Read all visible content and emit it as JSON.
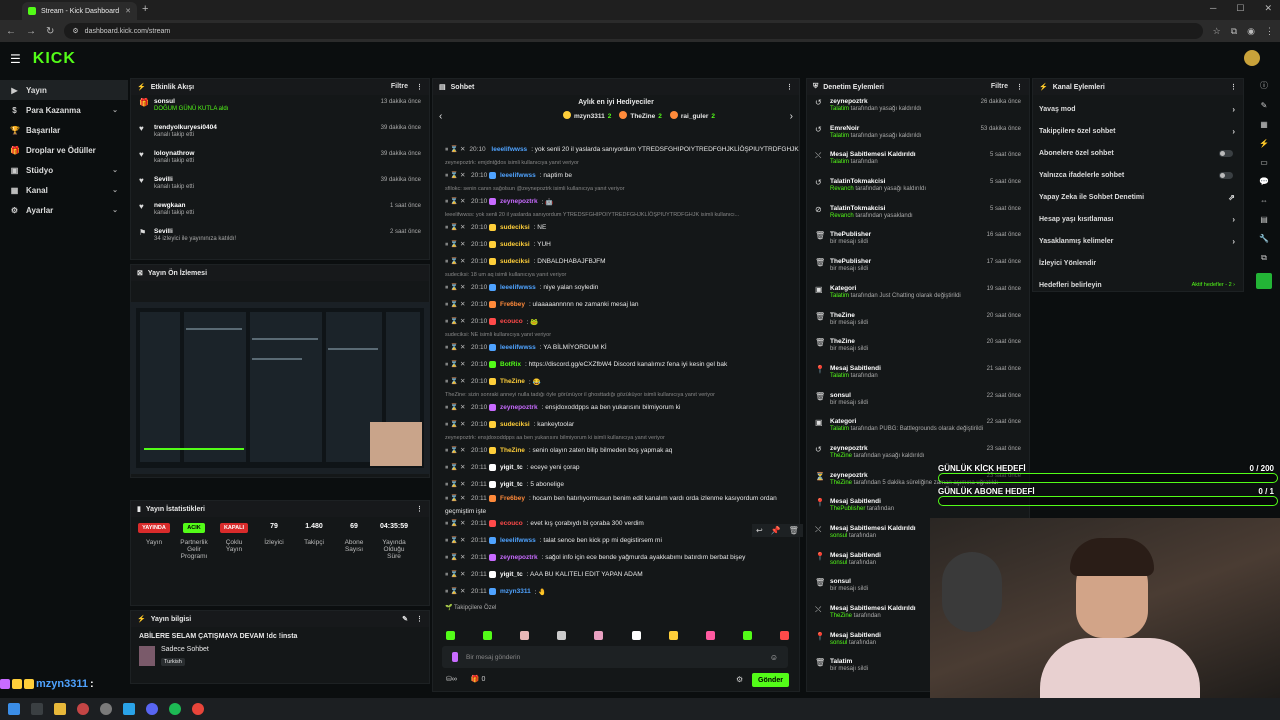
{
  "browser": {
    "tab_title": "Stream - Kick Dashboard",
    "url": "dashboard.kick.com/stream"
  },
  "app": {
    "logo": "KICK"
  },
  "sidebar": {
    "items": [
      {
        "label": "Yayın",
        "icon": "video-icon"
      },
      {
        "label": "Para Kazanma",
        "icon": "money-icon"
      },
      {
        "label": "Başarılar",
        "icon": "trophy-icon"
      },
      {
        "label": "Droplar ve Ödüller",
        "icon": "gift-icon"
      },
      {
        "label": "Stüdyo",
        "icon": "studio-icon"
      },
      {
        "label": "Kanal",
        "icon": "channel-icon"
      },
      {
        "label": "Ayarlar",
        "icon": "settings-icon"
      }
    ]
  },
  "activity": {
    "title": "Etkinlik Akışı",
    "filter": "Filtre",
    "rows": [
      {
        "name": "sonsul",
        "sub": "DOĞUM GÜNÜ KUTLA aldı",
        "time": "13 dakika önce",
        "icon": "gift-icon"
      },
      {
        "name": "trendyolkuryesi0404",
        "sub": "kanalı takip etti",
        "time": "39 dakika önce",
        "icon": "heart-icon"
      },
      {
        "name": "loloynathrow",
        "sub": "kanalı takip etti",
        "time": "39 dakika önce",
        "icon": "heart-icon"
      },
      {
        "name": "Sevilli",
        "sub": "kanalı takip etti",
        "time": "39 dakika önce",
        "icon": "heart-icon"
      },
      {
        "name": "newgkaan",
        "sub": "kanalı takip etti",
        "time": "1 saat önce",
        "icon": "heart-icon"
      },
      {
        "name": "Sevilli",
        "sub": "34 izleyici ile yayınınıza katıldı!",
        "time": "2 saat önce",
        "icon": "raid-icon"
      }
    ]
  },
  "preview": {
    "title": "Yayın Ön İzlemesi"
  },
  "stats": {
    "title": "Yayın İstatistikleri",
    "items": [
      {
        "badge": "YAYINDA",
        "label": "Yayın",
        "value": "",
        "color": "#d92b2b"
      },
      {
        "badge": "ACIK",
        "label": "Partnerlik Gelir Programı",
        "value": "",
        "color": "#53fc18"
      },
      {
        "badge": "KAPALI",
        "label": "Çoklu Yayın",
        "value": "",
        "color": "#d92b2b"
      },
      {
        "badge": "",
        "label": "İzleyici",
        "value": "79"
      },
      {
        "badge": "",
        "label": "Takipçi",
        "value": "1.480"
      },
      {
        "badge": "",
        "label": "Abone Sayısı",
        "value": "69"
      },
      {
        "badge": "",
        "label": "Yayında Olduğu Süre",
        "value": "04:35:59"
      }
    ]
  },
  "info": {
    "title": "Yayın bilgisi",
    "stream_title": "ABİLERE SELAM ÇATIŞMAYA DEVAM !dc !insta",
    "chat_mode": "Sadece Sohbet",
    "language": "Turkish"
  },
  "chat": {
    "title": "Sohbet",
    "top_title": "Aylık en iyi Hediyeciler",
    "top_gifters": [
      {
        "name": "mzyn3311",
        "count": "2"
      },
      {
        "name": "TheZine",
        "count": "2"
      },
      {
        "name": "rai_guler",
        "count": "2"
      }
    ],
    "messages": [
      {
        "t": "msg",
        "ts": "20:10",
        "user": "leeelifwwss",
        "color": "#4fa3ff",
        "text": ": yok senli 20 il yaslarda sanıyordum YTREDSFGHIPOIYTREDFGHJKLİÖŞPIUYTRDFGHJK"
      },
      {
        "t": "reply",
        "text": "zeynepoztrk: emjdntğdos isimli kullanıcıya yanıt veriyor"
      },
      {
        "t": "msg",
        "ts": "20:10",
        "user": "leeelifwwss",
        "color": "#4fa3ff",
        "text": ": naptim be"
      },
      {
        "t": "reply",
        "text": "sfilokc: senin canın sağolsun @zeynepoztrk isimli kullanıcıya yanıt veriyor"
      },
      {
        "t": "msg",
        "ts": "20:10",
        "user": "zeynepoztrk",
        "color": "#c86bff",
        "text": ": 🤖"
      },
      {
        "t": "reply",
        "text": "leeelifwwss: yok senli 20 il yaslarda sanıyordum YTREDSFGHIPOIYTREDFGHJKLİÖŞPIUYTRDFGHJK isimli kullanıcı..."
      },
      {
        "t": "msg",
        "ts": "20:10",
        "user": "sudeciksi",
        "color": "#ffcf3a",
        "text": ": NE"
      },
      {
        "t": "msg",
        "ts": "20:10",
        "user": "sudeciksi",
        "color": "#ffcf3a",
        "text": ": YUH"
      },
      {
        "t": "msg",
        "ts": "20:10",
        "user": "sudeciksi",
        "color": "#ffcf3a",
        "text": ": DNBALDHABAJFBJFM"
      },
      {
        "t": "reply",
        "text": "sudeciksi: 18 um aq isimli kullanıcıya yanıt veriyor"
      },
      {
        "t": "msg",
        "ts": "20:10",
        "user": "leeelifwwss",
        "color": "#4fa3ff",
        "text": ": niye yalan soyledin"
      },
      {
        "t": "msg",
        "ts": "20:10",
        "user": "Fre6bey",
        "color": "#ff8a3a",
        "text": ": ulaaaaannnnn ne zamanki mesaj lan"
      },
      {
        "t": "msg",
        "ts": "20:10",
        "user": "ecouco",
        "color": "#ff4a4a",
        "text": ": 🐸"
      },
      {
        "t": "reply",
        "text": "sudeciksi: NE isimli kullanıcıya yanıt veriyor"
      },
      {
        "t": "msg",
        "ts": "20:10",
        "user": "leeelifwwss",
        "color": "#4fa3ff",
        "text": ": YA BİLMİYORDUM Kİ"
      },
      {
        "t": "msg",
        "ts": "20:10",
        "user": "BotRix",
        "color": "#53fc18",
        "text": ": https://discord.gg/eCXZfbW4 Discord kanalımız fena iyi kesin gel bak"
      },
      {
        "t": "msg",
        "ts": "20:10",
        "user": "TheZine",
        "color": "#ffcf3a",
        "text": ": 😂"
      },
      {
        "t": "reply",
        "text": "TheZine: sizin sonraki anneyi nulla tadığı öyle görünüyor il ghosttadığı gözüküyor isimli kullanıcıya yanıt veriyor"
      },
      {
        "t": "msg",
        "ts": "20:10",
        "user": "zeynepoztrk",
        "color": "#c86bff",
        "text": ": ensjdoxoddpps aa ben yukarısını bilmiyorum ki"
      },
      {
        "t": "msg",
        "ts": "20:10",
        "user": "sudeciksi",
        "color": "#ffcf3a",
        "text": ": kankeytoolar"
      },
      {
        "t": "reply",
        "text": "zeynepoztrk: ensjdoxoddpps aa ben yukarısını bilmiyorum ki isimli kullanıcıya yanıt veriyor"
      },
      {
        "t": "msg",
        "ts": "20:10",
        "user": "TheZine",
        "color": "#ffcf3a",
        "text": ": senin olayın zaten bilip bilmeden boş yapmak aq"
      },
      {
        "t": "msg",
        "ts": "20:11",
        "user": "yigit_tc",
        "color": "#ffffff",
        "text": ": eceye yeni çorap"
      },
      {
        "t": "msg",
        "ts": "20:11",
        "user": "yigit_tc",
        "color": "#ffffff",
        "text": ": 5 abonelige"
      },
      {
        "t": "msg2",
        "ts": "20:11",
        "user": "Fre6bey",
        "color": "#ff8a3a",
        "text": ": hocam ben hatırlıyormusun benim edit kanalım vardı orda izlenme kasıyordum ordan",
        "text2": "geçmiştim işte"
      },
      {
        "t": "msg",
        "ts": "20:11",
        "user": "ecouco",
        "color": "#ff4a4a",
        "text": ": evet kış çorabıydı bi çoraba 300 verdim"
      },
      {
        "t": "msg",
        "ts": "20:11",
        "user": "leeelifwwss",
        "color": "#4fa3ff",
        "text": ": talat sence ben kick pp mi degistirsem mi"
      },
      {
        "t": "msg",
        "ts": "20:11",
        "user": "zeynepoztrk",
        "color": "#c86bff",
        "text": ": sağol info için ece bende yağmurda ayakkabımı batırdım berbat bişey"
      },
      {
        "t": "msg",
        "ts": "20:11",
        "user": "yigit_tc",
        "color": "#ffffff",
        "text": ": AAA BU KALITELI EDIT YAPAN ADAM"
      },
      {
        "t": "msg",
        "ts": "20:11",
        "user": "mzyn3311",
        "color": "#4fa3ff",
        "text": ": 🤚"
      }
    ],
    "followers_only": "Takipçilere Özel",
    "input_placeholder": "Bir mesaj gönderin",
    "count": "0",
    "send": "Gönder"
  },
  "moderation": {
    "title": "Denetim Eylemleri",
    "filter": "Filtre",
    "rows": [
      {
        "name": "zeynepoztrk",
        "actor": "Talatim",
        "sub": " tarafından yasağı kaldırıldı",
        "time": "26 dakika önce",
        "icon": "undo-icon"
      },
      {
        "name": "EmreNoir",
        "actor": "Talatim",
        "sub": " tarafından yasağı kaldırıldı",
        "time": "53 dakika önce",
        "icon": "undo-icon"
      },
      {
        "name": "Mesaj Sabitlemesi Kaldırıldı",
        "actor": "Talatim",
        "sub": " tarafından",
        "time": "5 saat önce",
        "icon": "unpin-icon"
      },
      {
        "name": "TalatinTokmakcisi",
        "actor": "Revanch",
        "sub": " tarafından yasağı kaldırıldı",
        "time": "5 saat önce",
        "icon": "undo-icon"
      },
      {
        "name": "TalatinTokmakcisi",
        "actor": "Revanch",
        "sub": " tarafından yasaklandı",
        "time": "5 saat önce",
        "icon": "ban-icon"
      },
      {
        "name": "ThePublisher",
        "actor": "",
        "sub": "bir mesajı sildi",
        "time": "16 saat önce",
        "icon": "trash-icon"
      },
      {
        "name": "ThePublisher",
        "actor": "",
        "sub": "bir mesajı sildi",
        "time": "17 saat önce",
        "icon": "trash-icon"
      },
      {
        "name": "Kategori",
        "actor": "Talatim",
        "sub": " tarafından Just Chatting olarak değiştirildi",
        "time": "19 saat önce",
        "icon": "category-icon"
      },
      {
        "name": "TheZine",
        "actor": "",
        "sub": "bir mesajı sildi",
        "time": "20 saat önce",
        "icon": "trash-icon"
      },
      {
        "name": "TheZine",
        "actor": "",
        "sub": "bir mesajı sildi",
        "time": "20 saat önce",
        "icon": "trash-icon"
      },
      {
        "name": "Mesaj Sabitlendi",
        "actor": "Talatim",
        "sub": " tarafından",
        "time": "21 saat önce",
        "icon": "pin-icon"
      },
      {
        "name": "sonsul",
        "actor": "",
        "sub": "bir mesajı sildi",
        "time": "22 saat önce",
        "icon": "trash-icon"
      },
      {
        "name": "Kategori",
        "actor": "Talatim",
        "sub": " tarafından PUBG: Battlegrounds olarak değiştirildi",
        "time": "22 saat önce",
        "icon": "category-icon"
      },
      {
        "name": "zeynepoztrk",
        "actor": "TheZine",
        "sub": " tarafından yasağı kaldırıldı",
        "time": "23 saat önce",
        "icon": "undo-icon"
      },
      {
        "name": "zeynepoztrk",
        "actor": "TheZine",
        "sub": " tarafından 5 dakika süreliğine zaman aşımına uğratıldı",
        "time": "23 saat önce",
        "icon": "timeout-icon"
      },
      {
        "name": "Mesaj Sabitlendi",
        "actor": "ThePublisher",
        "sub": " tarafından",
        "time": "",
        "icon": "pin-icon"
      },
      {
        "name": "Mesaj Sabitlemesi Kaldırıldı",
        "actor": "sonsul",
        "sub": " tarafından",
        "time": "",
        "icon": "unpin-icon"
      },
      {
        "name": "Mesaj Sabitlendi",
        "actor": "sonsul",
        "sub": " tarafından",
        "time": "",
        "icon": "pin-icon"
      },
      {
        "name": "sonsul",
        "actor": "",
        "sub": "bir mesajı sildi",
        "time": "",
        "icon": "trash-icon"
      },
      {
        "name": "Mesaj Sabitlemesi Kaldırıldı",
        "actor": "TheZine",
        "sub": " tarafından",
        "time": "",
        "icon": "unpin-icon"
      },
      {
        "name": "Mesaj Sabitlendi",
        "actor": "sonsul",
        "sub": " tarafından",
        "time": "",
        "icon": "pin-icon"
      },
      {
        "name": "Talatim",
        "actor": "",
        "sub": "bir mesajı sildi",
        "time": "",
        "icon": "trash-icon"
      }
    ]
  },
  "channel": {
    "title": "Kanal Eylemleri",
    "rows": [
      {
        "label": "Yavaş mod",
        "kind": "chevron"
      },
      {
        "label": "Takipçilere özel sohbet",
        "kind": "chevron"
      },
      {
        "label": "Abonelere özel sohbet",
        "kind": "toggle"
      },
      {
        "label": "Yalnızca ifadelerle sohbet",
        "kind": "toggle"
      },
      {
        "label": "Yapay Zeka ile Sohbet Denetimi",
        "kind": "external"
      },
      {
        "label": "Hesap yaşı kısıtlaması",
        "kind": "chevron"
      },
      {
        "label": "Yasaklanmış kelimeler",
        "kind": "chevron"
      },
      {
        "label": "İzleyici Yönlendir",
        "kind": "none"
      },
      {
        "label": "Hedefleri belirleyin",
        "kind": "goals"
      }
    ],
    "active_goals": "Aktif hedefler - 2"
  },
  "goals": [
    {
      "label": "GÜNLÜK KİCK HEDEFİ",
      "value": "0 / 200",
      "fraction": 0
    },
    {
      "label": "GÜNLÜK ABONE HEDEFİ",
      "value": "0 / 1",
      "fraction": 0
    }
  ],
  "overlay": {
    "username": "mzyn3311",
    "suffix": ":"
  }
}
